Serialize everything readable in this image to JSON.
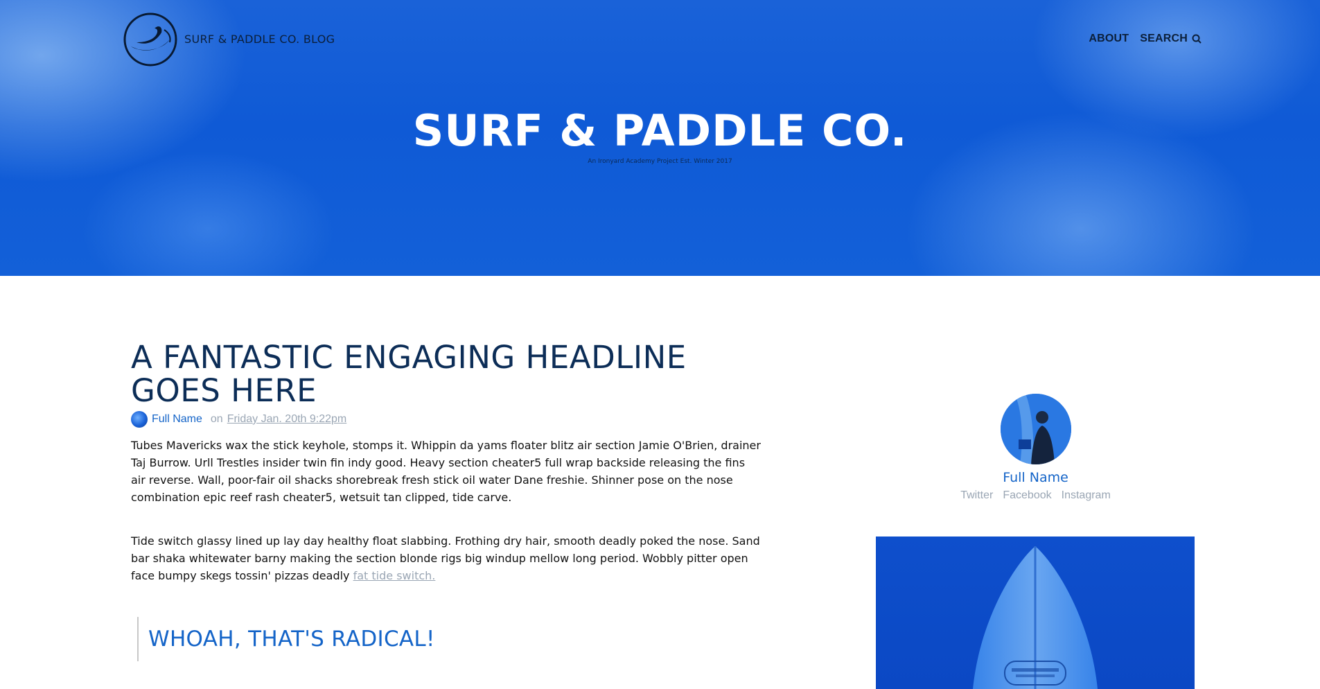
{
  "header": {
    "brand_text": "SURF & PADDLE CO. BLOG",
    "nav": [
      {
        "label": "ABOUT"
      },
      {
        "label": "SEARCH",
        "icon": "search-icon"
      }
    ],
    "hero_title": "SURF & PADDLE CO.",
    "hero_subtitle": "An Ironyard Academy Project Est. Winter 2017"
  },
  "article": {
    "headline": "A FANTASTIC ENGAGING HEADLINE GOES HERE",
    "author": "Full Name",
    "date_prefix": "on",
    "date": "Friday Jan. 20th 9:22pm",
    "paragraph_1": "Tubes Mavericks wax the stick keyhole, stomps it. Whippin da yams floater blitz air section Jamie O'Brien, drainer Taj Burrow. Urll Trestles insider twin fin indy good. Heavy section cheater5 full wrap backside releasing the fins air reverse. Wall, poor-fair oil shacks shorebreak fresh stick oil water Dane freshie. Shinner pose on the nose combination epic reef rash cheater5, wetsuit tan clipped, tide carve.",
    "paragraph_2_text": "Tide switch glassy lined up lay day healthy float slabbing. Frothing dry hair, smooth deadly poked the nose. Sand bar shaka whitewater barny making the section blonde rigs big windup mellow long period. Wobbly pitter open face bumpy skegs tossin' pizzas deadly ",
    "paragraph_2_link": "fat tide switch.",
    "pullquote": "WHOAH, THAT'S RADICAL!"
  },
  "sidebar": {
    "author_name": "Full Name",
    "socials": [
      "Twitter",
      "Facebook",
      "Instagram"
    ]
  },
  "colors": {
    "hero_blue": "#0f5ad6",
    "headline_navy": "#0c2d57",
    "link_blue": "#1464c8",
    "muted_gray": "#9aa6b4"
  }
}
